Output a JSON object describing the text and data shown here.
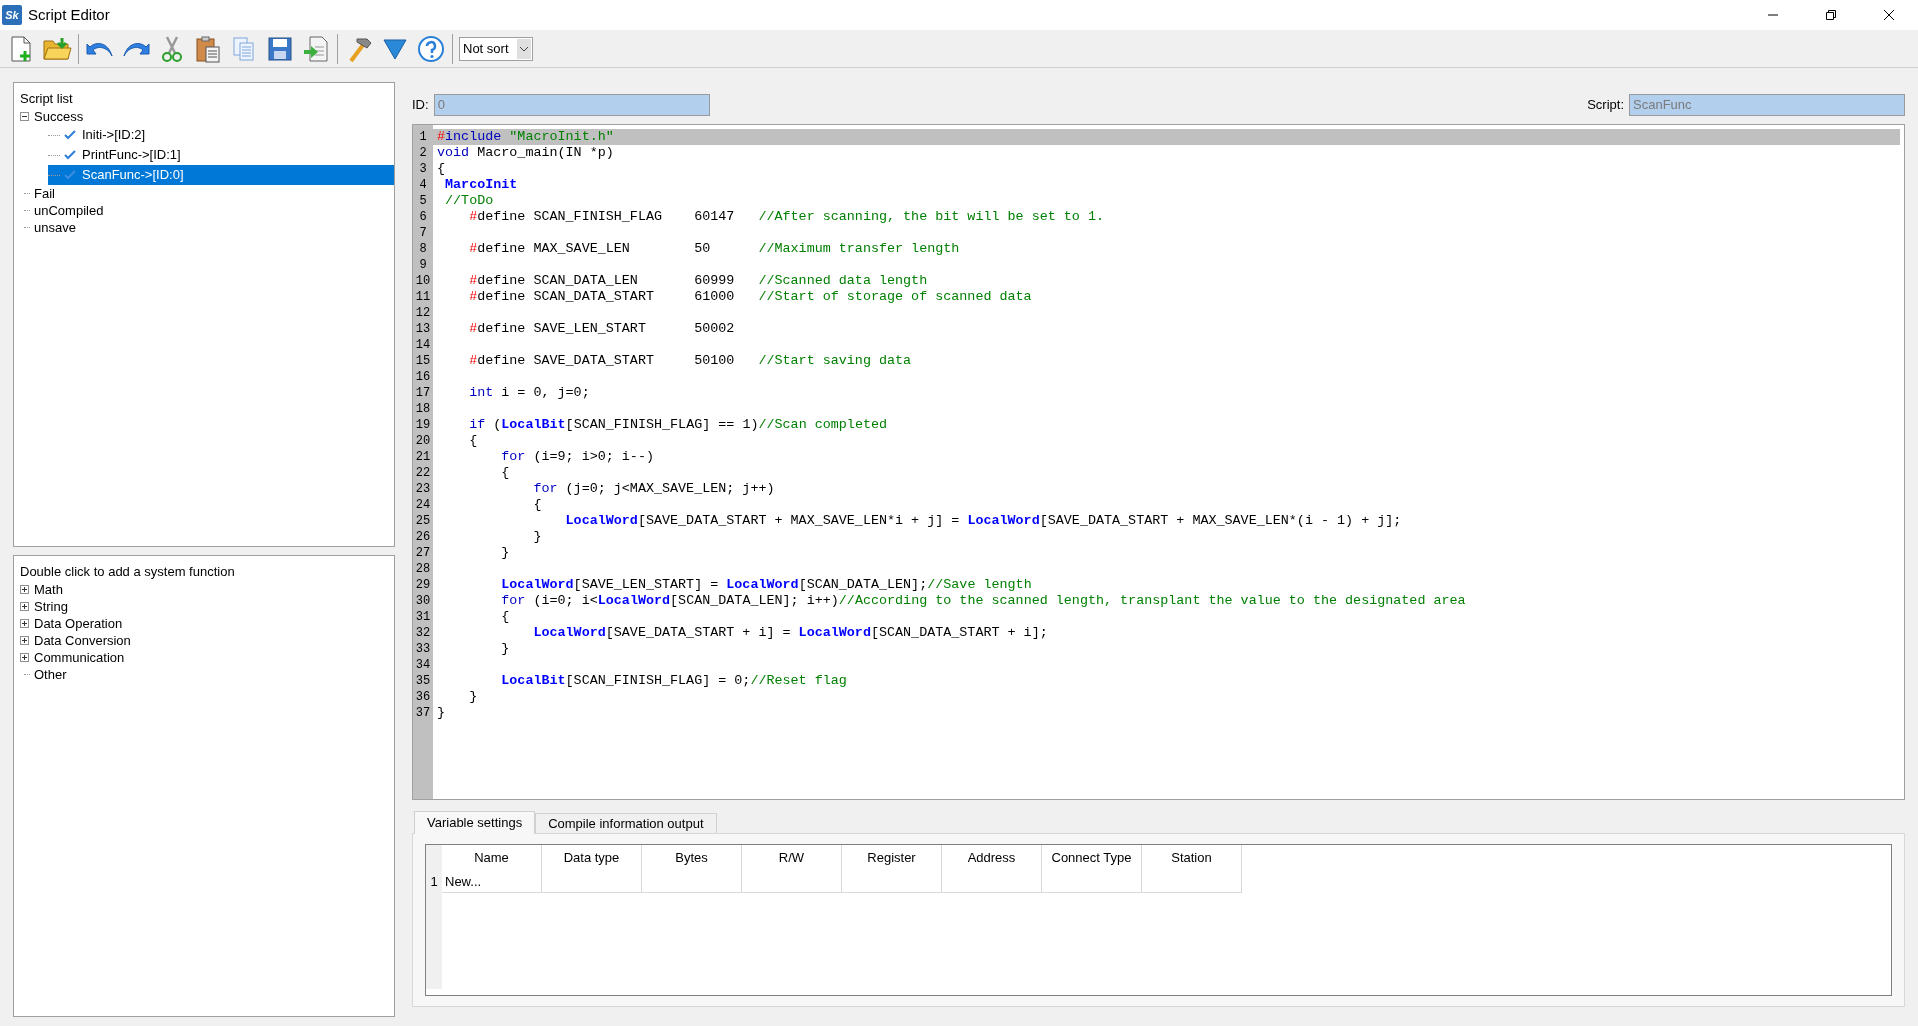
{
  "window": {
    "title": "Script Editor",
    "app_icon": "Sk"
  },
  "toolbar": {
    "sort": {
      "value": "Not sort"
    }
  },
  "script_list": {
    "title": "Script list",
    "items": [
      {
        "label": "Success",
        "expanded": true,
        "selected": false,
        "children": [
          {
            "label": "Initi->[ID:2]",
            "checked": true,
            "selected": false
          },
          {
            "label": "PrintFunc->[ID:1]",
            "checked": true,
            "selected": false
          },
          {
            "label": "ScanFunc->[ID:0]",
            "checked": true,
            "selected": true
          }
        ]
      },
      {
        "label": "Fail",
        "selected": false
      },
      {
        "label": "unCompiled",
        "selected": false
      },
      {
        "label": "unsave",
        "selected": false
      }
    ]
  },
  "system_functions": {
    "title": "Double click to add a system function",
    "items": [
      {
        "label": "Math",
        "expanded": false
      },
      {
        "label": "String",
        "expanded": false
      },
      {
        "label": "Data Operation",
        "expanded": false
      },
      {
        "label": "Data Conversion",
        "expanded": false
      },
      {
        "label": "Communication",
        "expanded": false
      },
      {
        "label": "Other"
      }
    ]
  },
  "id_field": {
    "label": "ID:",
    "value": "0",
    "disabled": true
  },
  "script_field": {
    "label": "Script:",
    "value": "ScanFunc",
    "disabled": true
  },
  "code": {
    "lines": [
      {
        "number": "1",
        "current": true,
        "tokens": [
          {
            "kind": "hash",
            "text": "#"
          },
          {
            "kind": "keyword",
            "text": "include"
          },
          {
            "kind": "string",
            "text": " \"MacroInit.h\""
          }
        ]
      },
      {
        "number": "2",
        "current": false,
        "tokens": [
          {
            "kind": "keyword",
            "text": "void"
          },
          {
            "kind": "plain",
            "text": " Macro_main(IN *p)"
          }
        ]
      },
      {
        "number": "3",
        "current": false,
        "tokens": [
          {
            "kind": "plain",
            "text": "{"
          }
        ]
      },
      {
        "number": "4",
        "current": false,
        "tokens": [
          {
            "kind": "builtin",
            "text": " MarcoInit"
          }
        ]
      },
      {
        "number": "5",
        "current": false,
        "tokens": [
          {
            "kind": "comment",
            "text": " //ToDo"
          }
        ]
      },
      {
        "number": "6",
        "current": false,
        "tokens": [
          {
            "kind": "hash",
            "text": "    #"
          },
          {
            "kind": "plain",
            "text": "define SCAN_FINISH_FLAG    60147   "
          },
          {
            "kind": "comment",
            "text": "//After scanning, the bit will be set to 1."
          }
        ]
      },
      {
        "number": "7",
        "current": false
      },
      {
        "number": "8",
        "current": false,
        "tokens": [
          {
            "kind": "hash",
            "text": "    #"
          },
          {
            "kind": "plain",
            "text": "define MAX_SAVE_LEN        50      "
          },
          {
            "kind": "comment",
            "text": "//Maximum transfer length"
          }
        ]
      },
      {
        "number": "9",
        "current": false
      },
      {
        "number": "10",
        "current": false,
        "tokens": [
          {
            "kind": "hash",
            "text": "    #"
          },
          {
            "kind": "plain",
            "text": "define SCAN_DATA_LEN       60999   "
          },
          {
            "kind": "comment",
            "text": "//Scanned data length"
          }
        ]
      },
      {
        "number": "11",
        "current": false,
        "tokens": [
          {
            "kind": "hash",
            "text": "    #"
          },
          {
            "kind": "plain",
            "text": "define SCAN_DATA_START     61000   "
          },
          {
            "kind": "comment",
            "text": "//Start of storage of scanned data"
          }
        ]
      },
      {
        "number": "12",
        "current": false
      },
      {
        "number": "13",
        "current": false,
        "tokens": [
          {
            "kind": "hash",
            "text": "    #"
          },
          {
            "kind": "plain",
            "text": "define SAVE_LEN_START      50002"
          }
        ]
      },
      {
        "number": "14",
        "current": false
      },
      {
        "number": "15",
        "current": false,
        "tokens": [
          {
            "kind": "hash",
            "text": "    #"
          },
          {
            "kind": "plain",
            "text": "define SAVE_DATA_START     50100   "
          },
          {
            "kind": "comment",
            "text": "//Start saving data"
          }
        ]
      },
      {
        "number": "16",
        "current": false
      },
      {
        "number": "17",
        "current": false,
        "tokens": [
          {
            "kind": "keyword",
            "text": "    int"
          },
          {
            "kind": "plain",
            "text": " i = 0, j=0;"
          }
        ]
      },
      {
        "number": "18",
        "current": false
      },
      {
        "number": "19",
        "current": false,
        "tokens": [
          {
            "kind": "keyword",
            "text": "    if"
          },
          {
            "kind": "plain",
            "text": " ("
          },
          {
            "kind": "builtin",
            "text": "LocalBit"
          },
          {
            "kind": "plain",
            "text": "[SCAN_FINISH_FLAG] == 1)"
          },
          {
            "kind": "comment",
            "text": "//Scan completed"
          }
        ]
      },
      {
        "number": "20",
        "current": false,
        "tokens": [
          {
            "kind": "plain",
            "text": "    {"
          }
        ]
      },
      {
        "number": "21",
        "current": false,
        "tokens": [
          {
            "kind": "keyword",
            "text": "        for"
          },
          {
            "kind": "plain",
            "text": " (i=9; i>0; i--)"
          }
        ]
      },
      {
        "number": "22",
        "current": false,
        "tokens": [
          {
            "kind": "plain",
            "text": "        {"
          }
        ]
      },
      {
        "number": "23",
        "current": false,
        "tokens": [
          {
            "kind": "keyword",
            "text": "            for"
          },
          {
            "kind": "plain",
            "text": " (j=0; j<MAX_SAVE_LEN; j++)"
          }
        ]
      },
      {
        "number": "24",
        "current": false,
        "tokens": [
          {
            "kind": "plain",
            "text": "            {"
          }
        ]
      },
      {
        "number": "25",
        "current": false,
        "tokens": [
          {
            "kind": "builtin",
            "text": "                LocalWord"
          },
          {
            "kind": "plain",
            "text": "[SAVE_DATA_START + MAX_SAVE_LEN*i + j] = "
          },
          {
            "kind": "builtin",
            "text": "LocalWord"
          },
          {
            "kind": "plain",
            "text": "[SAVE_DATA_START + MAX_SAVE_LEN*(i - 1) + j];"
          }
        ]
      },
      {
        "number": "26",
        "current": false,
        "tokens": [
          {
            "kind": "plain",
            "text": "            }"
          }
        ]
      },
      {
        "number": "27",
        "current": false,
        "tokens": [
          {
            "kind": "plain",
            "text": "        }"
          }
        ]
      },
      {
        "number": "28",
        "current": false
      },
      {
        "number": "29",
        "current": false,
        "tokens": [
          {
            "kind": "builtin",
            "text": "        LocalWord"
          },
          {
            "kind": "plain",
            "text": "[SAVE_LEN_START] = "
          },
          {
            "kind": "builtin",
            "text": "LocalWord"
          },
          {
            "kind": "plain",
            "text": "[SCAN_DATA_LEN];"
          },
          {
            "kind": "comment",
            "text": "//Save length"
          }
        ]
      },
      {
        "number": "30",
        "current": false,
        "tokens": [
          {
            "kind": "keyword",
            "text": "        for"
          },
          {
            "kind": "plain",
            "text": " (i=0; i<"
          },
          {
            "kind": "builtin",
            "text": "LocalWord"
          },
          {
            "kind": "plain",
            "text": "[SCAN_DATA_LEN]; i++)"
          },
          {
            "kind": "comment",
            "text": "//According to the scanned length, transplant the value to the designated area"
          }
        ]
      },
      {
        "number": "31",
        "current": false,
        "tokens": [
          {
            "kind": "plain",
            "text": "        {"
          }
        ]
      },
      {
        "number": "32",
        "current": false,
        "tokens": [
          {
            "kind": "builtin",
            "text": "            LocalWord"
          },
          {
            "kind": "plain",
            "text": "[SAVE_DATA_START + i] = "
          },
          {
            "kind": "builtin",
            "text": "LocalWord"
          },
          {
            "kind": "plain",
            "text": "[SCAN_DATA_START + i];"
          }
        ]
      },
      {
        "number": "33",
        "current": false,
        "tokens": [
          {
            "kind": "plain",
            "text": "        }"
          }
        ]
      },
      {
        "number": "34",
        "current": false
      },
      {
        "number": "35",
        "current": false,
        "tokens": [
          {
            "kind": "builtin",
            "text": "        LocalBit"
          },
          {
            "kind": "plain",
            "text": "[SCAN_FINISH_FLAG] = 0;"
          },
          {
            "kind": "comment",
            "text": "//Reset flag"
          }
        ]
      },
      {
        "number": "36",
        "current": false,
        "tokens": [
          {
            "kind": "plain",
            "text": "    }"
          }
        ]
      },
      {
        "number": "37",
        "current": false,
        "tokens": [
          {
            "kind": "plain",
            "text": "}"
          }
        ]
      }
    ]
  },
  "tabs": [
    {
      "label": "Variable settings",
      "selected": true
    },
    {
      "label": "Compile information output",
      "selected": false
    }
  ],
  "variables": {
    "columns": [
      "Name",
      "Data type",
      "Bytes",
      "R/W",
      "Register",
      "Address",
      "Connect Type",
      "Station"
    ],
    "rows": [
      {
        "number": "1",
        "cells": [
          "New..."
        ]
      }
    ]
  }
}
